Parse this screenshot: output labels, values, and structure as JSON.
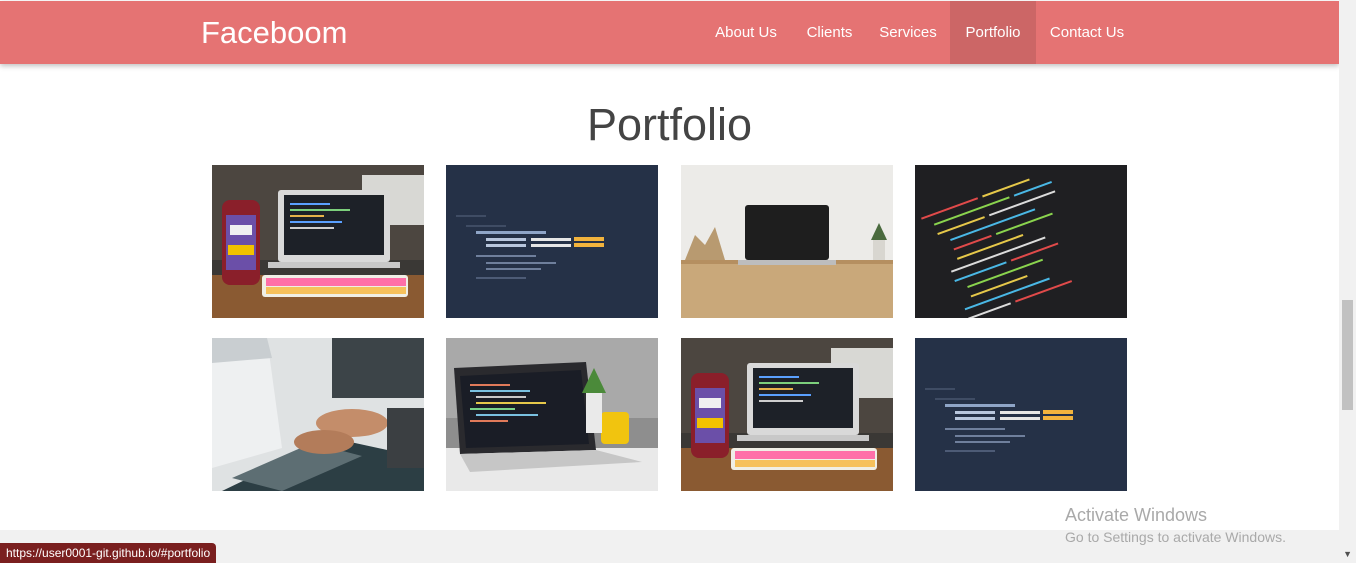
{
  "header": {
    "brand": "Faceboom"
  },
  "nav": {
    "items": [
      {
        "label": "About Us"
      },
      {
        "label": "Clients"
      },
      {
        "label": "Services"
      },
      {
        "label": "Portfolio"
      },
      {
        "label": "Contact Us"
      }
    ],
    "active": "Portfolio"
  },
  "portfolio": {
    "title": "Portfolio",
    "items": [
      {
        "subject": "laptop-on-desk"
      },
      {
        "subject": "code-on-screen"
      },
      {
        "subject": "laptop-on-wooden-table"
      },
      {
        "subject": "code-editor-closeup"
      },
      {
        "subject": "hands-typing-on-laptop"
      },
      {
        "subject": "laptop-with-plant-and-mug"
      },
      {
        "subject": "laptop-on-desk"
      },
      {
        "subject": "code-on-screen"
      }
    ]
  },
  "status_bar": {
    "url": "https://user0001-git.github.io/#portfolio"
  },
  "watermark": {
    "title": "Activate Windows",
    "subtitle": "Go to Settings to activate Windows."
  },
  "colors": {
    "navbar": "#e57373",
    "nav_active": "#cc6666",
    "status_bg": "#7a1f1f"
  }
}
